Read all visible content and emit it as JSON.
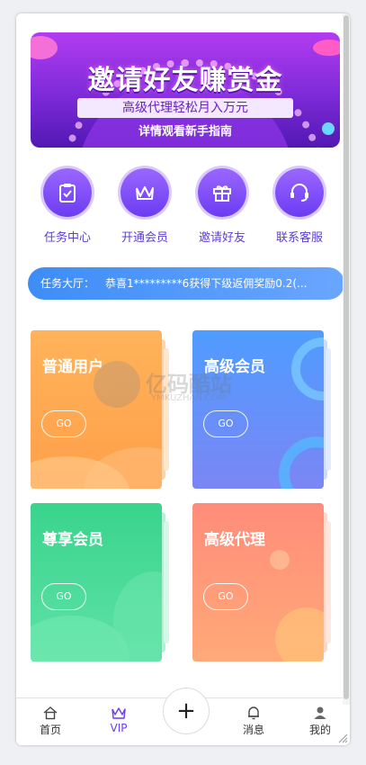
{
  "banner": {
    "title": "邀请好友赚赏金",
    "subtitle": "高级代理轻松月入万元",
    "guide": "详情观看新手指南"
  },
  "quick_actions": [
    {
      "label": "任务中心",
      "icon": "clipboard-icon"
    },
    {
      "label": "开通会员",
      "icon": "crown-icon"
    },
    {
      "label": "邀请好友",
      "icon": "gift-icon"
    },
    {
      "label": "联系客服",
      "icon": "headset-icon"
    }
  ],
  "notice": {
    "label": "任务大厅：",
    "message": "恭喜1*********6获得下级返佣奖励0.2(..."
  },
  "cards": [
    {
      "name": "普通用户",
      "button": "GO"
    },
    {
      "name": "高级会员",
      "button": "GO"
    },
    {
      "name": "尊享会员",
      "button": "GO"
    },
    {
      "name": "高级代理",
      "button": "GO"
    }
  ],
  "watermark": {
    "text": "亿码酷站",
    "sub": "YMKUZHAN.COM"
  },
  "tabbar": {
    "home": "首页",
    "vip": "VIP",
    "plus": "+",
    "messages": "消息",
    "mine": "我的"
  },
  "colors": {
    "accent": "#6b3cf2",
    "notice_bg": "#3d8df6",
    "card_orange": "#ffa64f",
    "card_blue": "#5b95fb",
    "card_green": "#45d998",
    "card_coral": "#ff9878"
  }
}
